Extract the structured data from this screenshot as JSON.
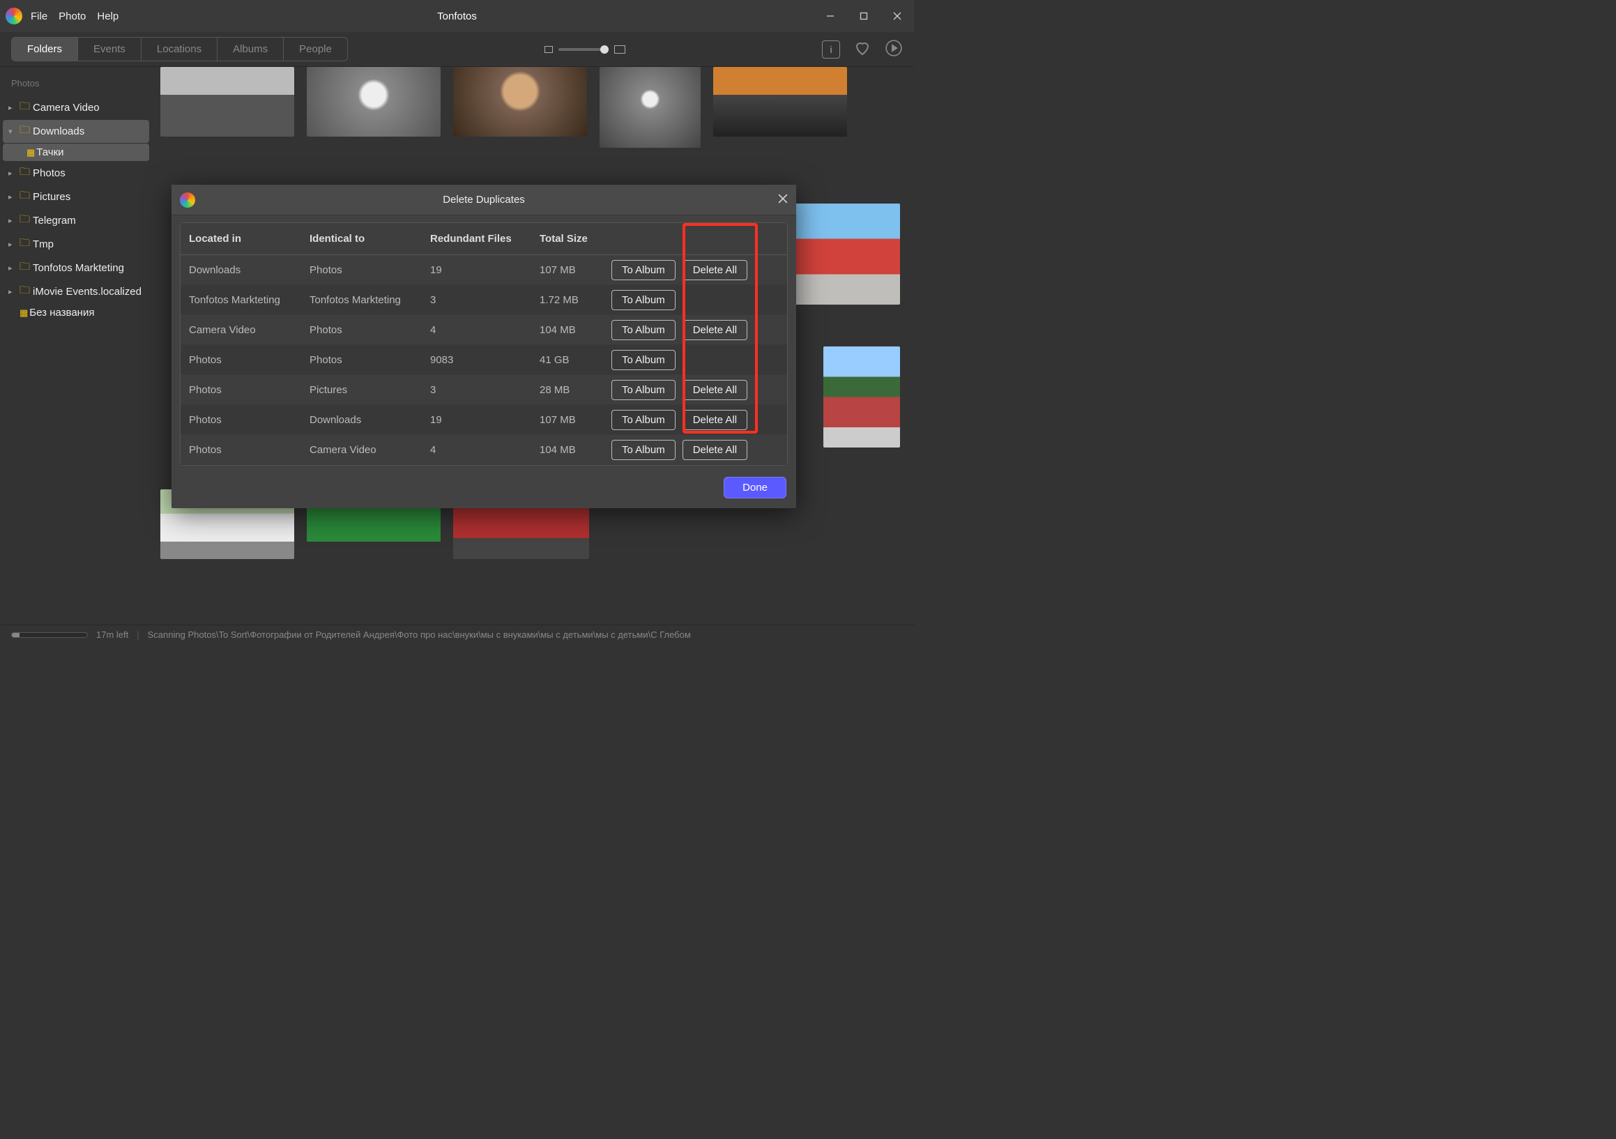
{
  "app": {
    "title": "Tonfotos",
    "menu": [
      "File",
      "Photo",
      "Help"
    ]
  },
  "tabs": {
    "items": [
      "Folders",
      "Events",
      "Locations",
      "Albums",
      "People"
    ],
    "active": 0
  },
  "sidebar": {
    "heading": "Photos",
    "items": [
      {
        "label": "Camera Video",
        "type": "folder",
        "expanded": false,
        "indent": 0
      },
      {
        "label": "Downloads",
        "type": "folder",
        "expanded": true,
        "indent": 0,
        "selected": true
      },
      {
        "label": "Тачки",
        "type": "album",
        "indent": 1,
        "selected": true
      },
      {
        "label": "Photos",
        "type": "folder",
        "expanded": false,
        "indent": 0
      },
      {
        "label": "Pictures",
        "type": "folder",
        "expanded": false,
        "indent": 0
      },
      {
        "label": "Telegram",
        "type": "folder",
        "expanded": false,
        "indent": 0
      },
      {
        "label": "Tmp",
        "type": "folder",
        "expanded": false,
        "indent": 0
      },
      {
        "label": "Tonfotos Markteting",
        "type": "folder",
        "expanded": false,
        "indent": 0
      },
      {
        "label": "iMovie Events.localized",
        "type": "folder",
        "expanded": false,
        "indent": 0
      },
      {
        "label": "Без названия",
        "type": "album",
        "indent": 0
      }
    ]
  },
  "dialog": {
    "title": "Delete Duplicates",
    "headers": [
      "Located in",
      "Identical to",
      "Redundant Files",
      "Total Size"
    ],
    "to_album_label": "To Album",
    "delete_all_label": "Delete All",
    "done_label": "Done",
    "rows": [
      {
        "located": "Downloads",
        "identical": "Photos",
        "redundant": "19",
        "size": "107 MB",
        "delete": true
      },
      {
        "located": "Tonfotos Markteting",
        "identical": "Tonfotos Markteting",
        "redundant": "3",
        "size": "1.72 MB",
        "delete": false
      },
      {
        "located": "Camera Video",
        "identical": "Photos",
        "redundant": "4",
        "size": "104 MB",
        "delete": true
      },
      {
        "located": "Photos",
        "identical": "Photos",
        "redundant": "9083",
        "size": "41 GB",
        "delete": false
      },
      {
        "located": "Photos",
        "identical": "Pictures",
        "redundant": "3",
        "size": "28 MB",
        "delete": true
      },
      {
        "located": "Photos",
        "identical": "Downloads",
        "redundant": "19",
        "size": "107 MB",
        "delete": true
      },
      {
        "located": "Photos",
        "identical": "Camera Video",
        "redundant": "4",
        "size": "104 MB",
        "delete": true
      }
    ]
  },
  "status": {
    "time_left": "17m left",
    "text": "Scanning Photos\\To Sort\\Фотографии от Родителей Андрея\\Фото про нас\\внуки\\мы с внуками\\мы с детьми\\мы с детьми\\С Глебом"
  }
}
